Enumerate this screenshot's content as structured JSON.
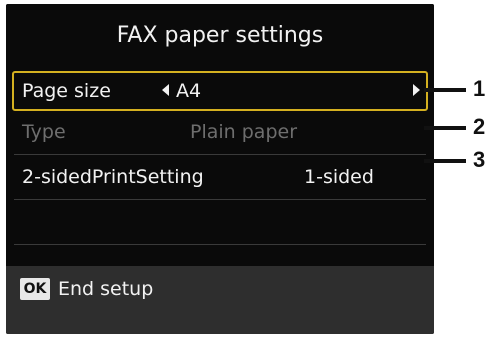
{
  "title": "FAX paper settings",
  "rows": [
    {
      "label": "Page size",
      "value": "A4"
    },
    {
      "label": "Type",
      "value": "Plain paper"
    },
    {
      "label": "2-sidedPrintSetting",
      "value": "1-sided"
    }
  ],
  "footer": {
    "ok_label": "OK",
    "action_label": "End setup"
  },
  "callouts": [
    "1",
    "2",
    "3"
  ],
  "colors": {
    "screen_bg": "#0a0a0a",
    "footer_bg": "#2e2e2e",
    "selection": "#d4b020",
    "disabled_text": "#6e6e6e"
  }
}
